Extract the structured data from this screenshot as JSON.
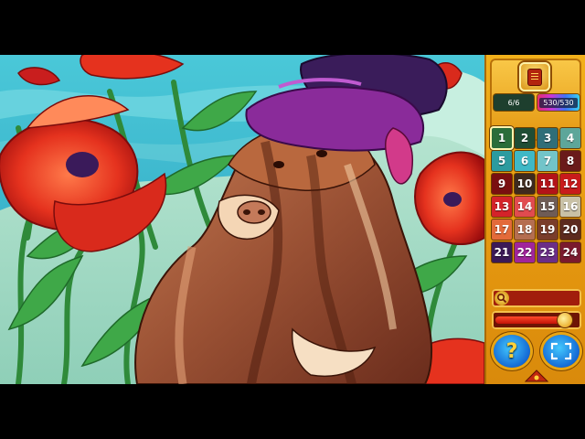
{
  "counters": {
    "colored": "6/6",
    "progress": "530/530"
  },
  "palette": [
    {
      "num": "1",
      "color": "#2b6d3a"
    },
    {
      "num": "2",
      "color": "#1f4d35"
    },
    {
      "num": "3",
      "color": "#2f6e78"
    },
    {
      "num": "4",
      "color": "#5da69a"
    },
    {
      "num": "5",
      "color": "#2c9b9f"
    },
    {
      "num": "6",
      "color": "#3fb8c6"
    },
    {
      "num": "7",
      "color": "#72c4c9"
    },
    {
      "num": "8",
      "color": "#6a1a1a"
    },
    {
      "num": "9",
      "color": "#7a0f10"
    },
    {
      "num": "10",
      "color": "#3e2a1e"
    },
    {
      "num": "11",
      "color": "#b31318"
    },
    {
      "num": "12",
      "color": "#c81b1b"
    },
    {
      "num": "13",
      "color": "#d4232a"
    },
    {
      "num": "14",
      "color": "#e14b4f"
    },
    {
      "num": "15",
      "color": "#6f5c55"
    },
    {
      "num": "16",
      "color": "#c9c1a6"
    },
    {
      "num": "17",
      "color": "#e36a3a"
    },
    {
      "num": "18",
      "color": "#b56e50"
    },
    {
      "num": "19",
      "color": "#7a3d2a"
    },
    {
      "num": "20",
      "color": "#5c2a1e"
    },
    {
      "num": "21",
      "color": "#3b1a57"
    },
    {
      "num": "22",
      "color": "#a0259a"
    },
    {
      "num": "23",
      "color": "#6b2e87"
    },
    {
      "num": "24",
      "color": "#7a1a2e"
    }
  ],
  "selected_color": "1",
  "zoom": {
    "level": 0.92
  },
  "colors": {
    "panel": "#e79a10",
    "accent": "#1469d4",
    "frame": "#a11e0c"
  },
  "icons": [
    "book-icon",
    "magnifier-icon",
    "question-icon",
    "fit-screen-icon",
    "palette-swatch-icon"
  ]
}
